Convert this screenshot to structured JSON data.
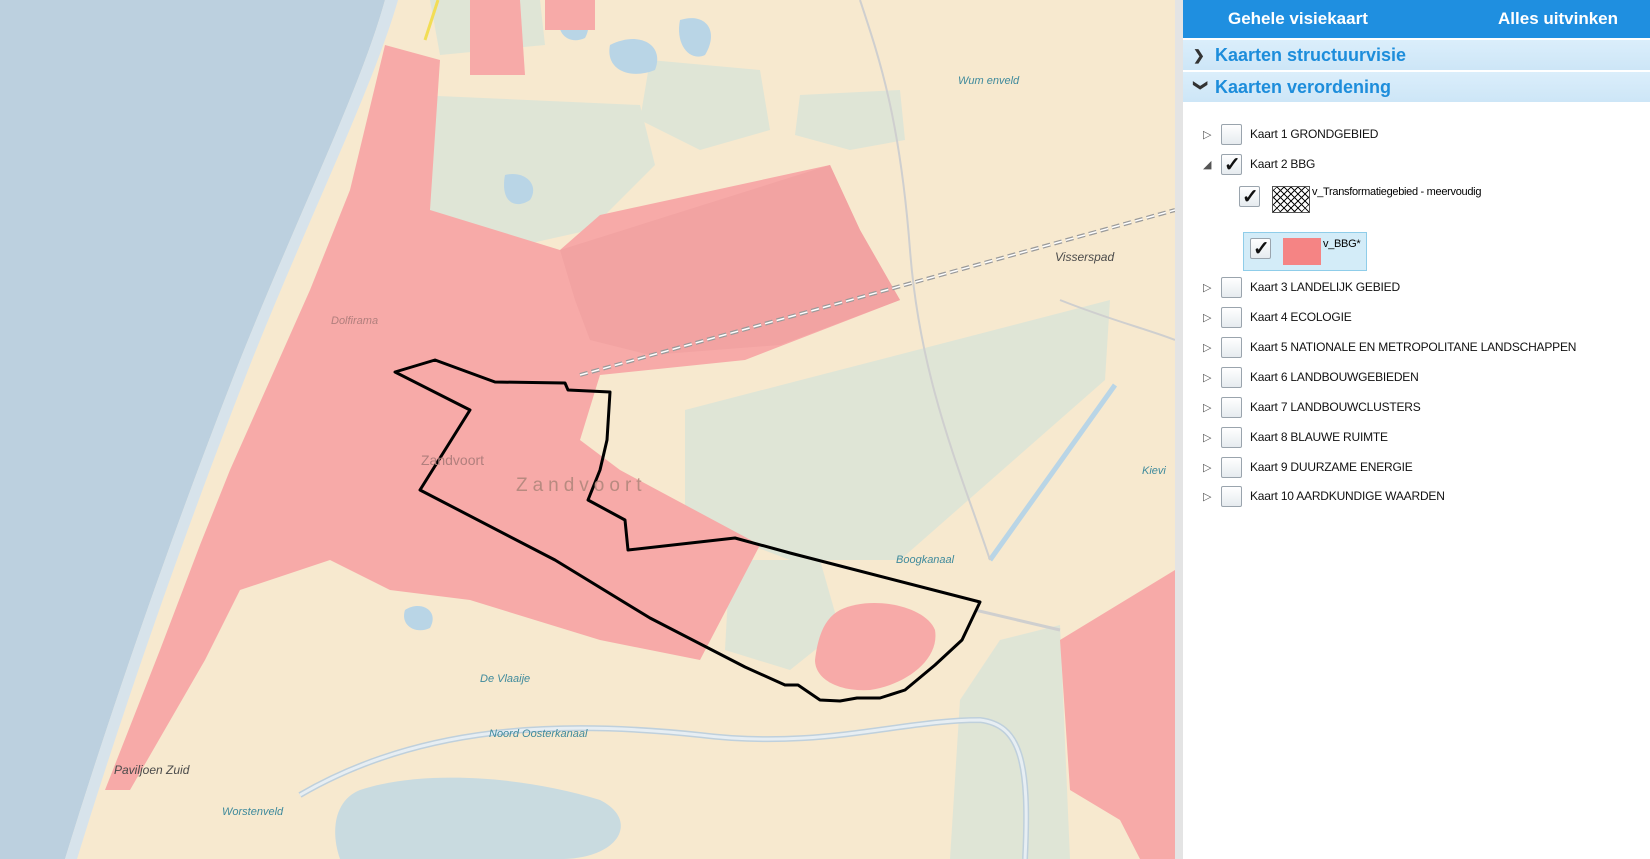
{
  "map": {
    "labels": {
      "wumenveld": "Wum enveld",
      "visserspad": "Visserspad",
      "dolfirama": "Dolfirama",
      "zandvoort_small": "Zandvoort",
      "zandvoort_big": "Zandvoort",
      "kievit": "Kievi",
      "boogkanaal": "Boogkanaal",
      "de_vlaaije": "De Vlaaije",
      "noord_oosterkanaal": "Noord Oosterkanaal",
      "paviljoen_zuid": "Paviljoen Zuid",
      "worstenveld": "Worstenveld"
    },
    "colors": {
      "sea": "#bcd0df",
      "land": "#f7e9cf",
      "built": "#f7aaa8",
      "green": "#dfe5d6",
      "water": "#b9d5e6",
      "outline": "#000000"
    }
  },
  "panel": {
    "topbar": {
      "full_map": "Gehele visiekaart",
      "uncheck_all": "Alles uitvinken"
    },
    "sections": {
      "structuurvisie": "Kaarten structuurvisie",
      "verordening": "Kaarten verordening"
    },
    "layers": [
      {
        "label": "Kaart 1 GRONDGEBIED",
        "checked": false
      },
      {
        "label": "Kaart 2 BBG",
        "checked": true
      },
      {
        "label": "Kaart 3 LANDELIJK GEBIED",
        "checked": false
      },
      {
        "label": "Kaart 4 ECOLOGIE",
        "checked": false
      },
      {
        "label": "Kaart 5 NATIONALE EN METROPOLITANE LANDSCHAPPEN",
        "checked": false
      },
      {
        "label": "Kaart 6 LANDBOUWGEBIEDEN",
        "checked": false
      },
      {
        "label": "Kaart 7 LANDBOUWCLUSTERS",
        "checked": false
      },
      {
        "label": "Kaart 8 BLAUWE RUIMTE",
        "checked": false
      },
      {
        "label": "Kaart 9 DUURZAME ENERGIE",
        "checked": false
      },
      {
        "label": "Kaart 10 AARDKUNDIGE WAARDEN",
        "checked": false
      }
    ],
    "sublayers": [
      {
        "label": "v_Transformatiegebied - meervoudig",
        "checked": true,
        "swatch": "hatch"
      },
      {
        "label": "v_BBG*",
        "checked": true,
        "swatch": "pink"
      }
    ]
  }
}
